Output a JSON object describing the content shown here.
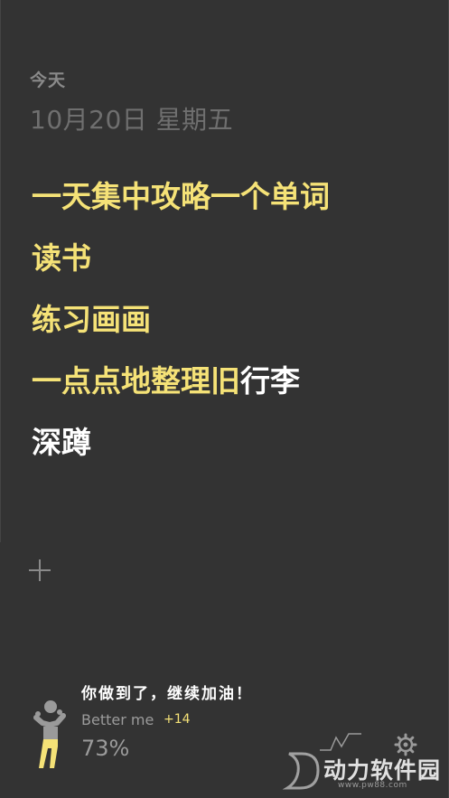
{
  "header": {
    "today_label": "今天",
    "date_label": "10月20日 星期五"
  },
  "tasks": [
    {
      "done": "一天集中攻略一个单词",
      "todo": ""
    },
    {
      "done": "读书",
      "todo": ""
    },
    {
      "done": "练习画画",
      "todo": ""
    },
    {
      "done": "一点点地整理旧",
      "todo": "行李"
    },
    {
      "done": "",
      "todo": "深蹲"
    }
  ],
  "footer": {
    "motto": "你做到了，继续加油！",
    "brand": "Better me",
    "delta": "+14",
    "percent": "73%"
  },
  "icons": {
    "add": "plus-icon",
    "trend": "trend-line-icon",
    "settings": "gear-icon",
    "figure": "cheering-person-icon"
  },
  "watermark": {
    "text": "动力软件园",
    "url": "www.pw88.com"
  },
  "colors": {
    "background": "#333333",
    "accent": "#f5e277",
    "text": "#ffffff",
    "muted": "#8a8a8a"
  }
}
